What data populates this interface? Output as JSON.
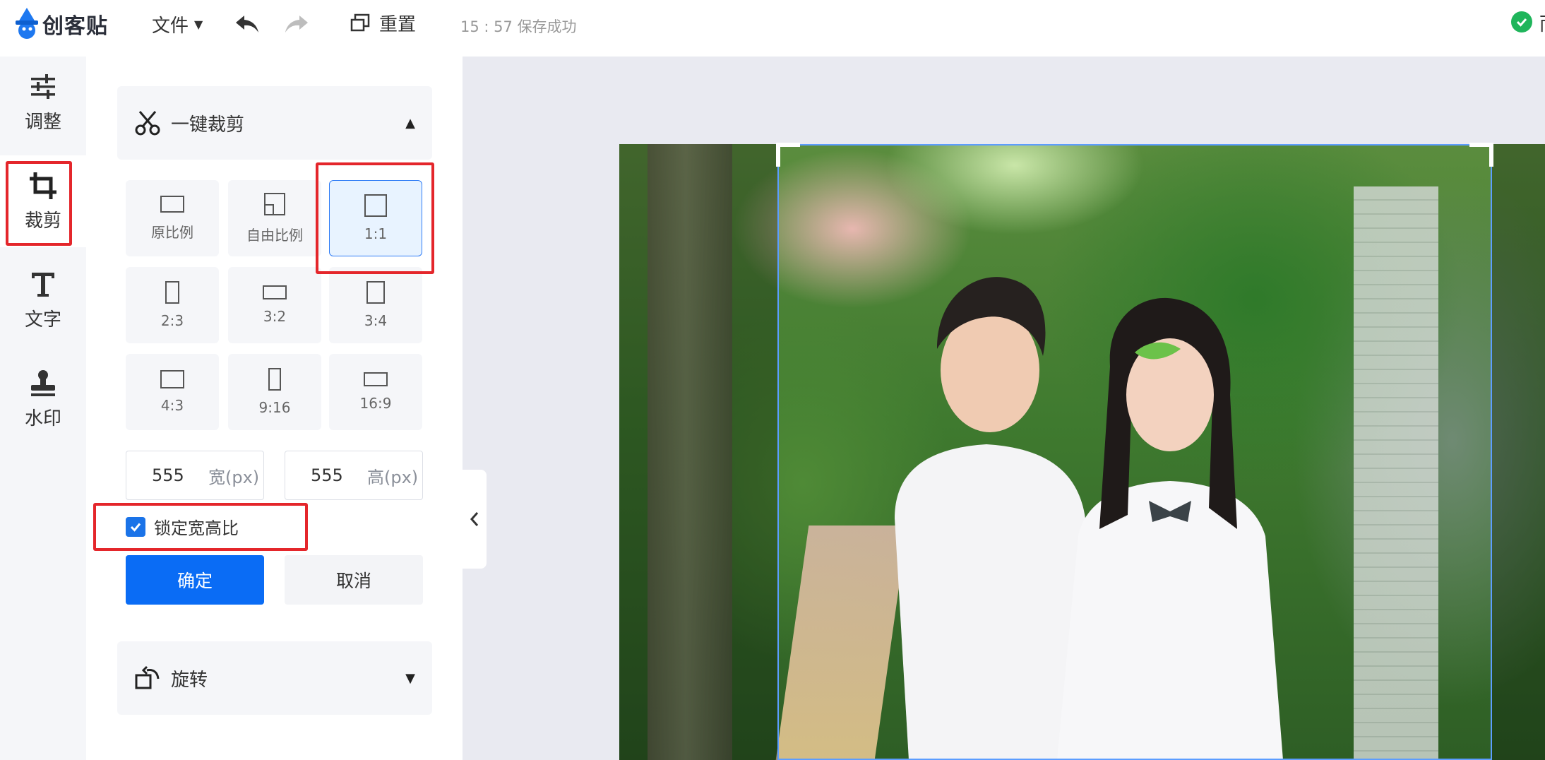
{
  "app": {
    "logo_text": "创客贴"
  },
  "toolbar": {
    "file_label": "文件",
    "reset_label": "重置",
    "save_status": "15 : 57 保存成功",
    "right_partial": "而"
  },
  "rail": {
    "items": [
      {
        "label": "调整",
        "icon": "sliders-icon"
      },
      {
        "label": "裁剪",
        "icon": "crop-icon"
      },
      {
        "label": "文字",
        "icon": "text-icon"
      },
      {
        "label": "水印",
        "icon": "stamp-icon"
      }
    ]
  },
  "crop_section": {
    "title": "一键裁剪",
    "ratios": [
      {
        "label": "原比例"
      },
      {
        "label": "自由比例"
      },
      {
        "label": "1:1"
      },
      {
        "label": "2:3"
      },
      {
        "label": "3:2"
      },
      {
        "label": "3:4"
      },
      {
        "label": "4:3"
      },
      {
        "label": "9:16"
      },
      {
        "label": "16:9"
      }
    ],
    "selected": "1:1",
    "width_value": "555",
    "width_unit": "宽(px)",
    "height_value": "555",
    "height_unit": "高(px)",
    "lock_label": "锁定宽高比",
    "lock_checked": true,
    "confirm_label": "确定",
    "cancel_label": "取消"
  },
  "rotate_section": {
    "title": "旋转"
  },
  "colors": {
    "accent": "#0a6cf5",
    "highlight": "#e4262b",
    "success": "#1fb55b"
  }
}
